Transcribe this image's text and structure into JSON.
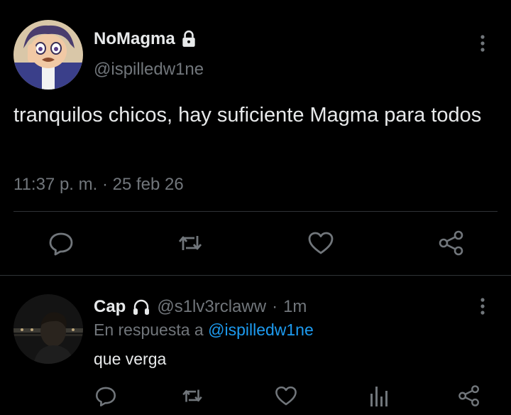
{
  "main_tweet": {
    "display_name": "NoMagma",
    "handle": "@ispilledw1ne",
    "text": "tranquilos chicos, hay suficiente Magma para todos",
    "time": "11:37 p. m.",
    "separator": " · ",
    "date": "25 feb 26",
    "icons": {
      "lock": "lock-icon",
      "more": "more-vertical-icon",
      "reply": "reply-icon",
      "retweet": "retweet-icon",
      "like": "heart-icon",
      "share": "share-icon"
    }
  },
  "reply": {
    "display_name": "Cap",
    "badge_icon": "headphones-icon",
    "handle": "@s1lv3rclaww",
    "separator": "·",
    "time_ago": "1m",
    "replying_prefix": "En respuesta a",
    "replying_to": "@ispilledw1ne",
    "text": "que verga",
    "icons": {
      "reply": "reply-icon",
      "retweet": "retweet-icon",
      "like": "heart-icon",
      "views": "analytics-icon",
      "share": "share-icon"
    }
  },
  "colors": {
    "background": "#000000",
    "primary_text": "#e7e9ea",
    "secondary_text": "#71767b",
    "link": "#1d9bf0",
    "divider": "#2f3336"
  }
}
